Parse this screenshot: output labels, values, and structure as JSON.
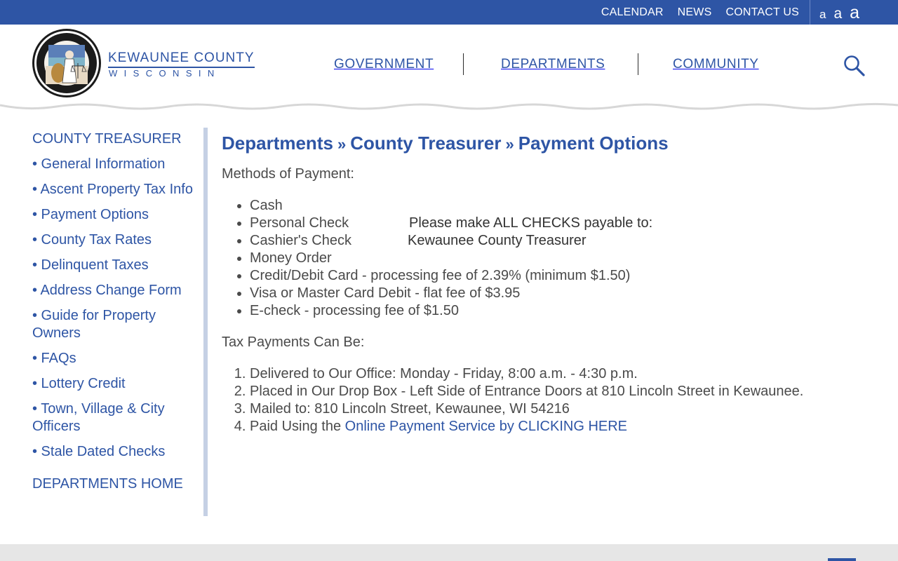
{
  "top_nav": {
    "links": [
      "CALENDAR",
      "NEWS",
      "CONTACT US"
    ],
    "font_sizes": [
      "a",
      "a",
      "a"
    ]
  },
  "brand": {
    "name": "KEWAUNEE COUNTY",
    "state": "WISCONSIN"
  },
  "main_nav": [
    "GOVERNMENT",
    "DEPARTMENTS",
    "COMMUNITY"
  ],
  "sidebar": {
    "heading": "COUNTY TREASURER",
    "items": [
      "• General Information",
      "• Ascent Property Tax Info",
      "• Payment Options",
      "• County Tax Rates",
      "• Delinquent Taxes",
      "• Address Change Form",
      "• Guide for Property Owners",
      "• FAQs",
      "• Lottery Credit",
      "• Town, Village & City Officers",
      "• Stale Dated Checks"
    ],
    "footer_link": "DEPARTMENTS HOME"
  },
  "content": {
    "breadcrumb": [
      "Departments",
      "County Treasurer",
      "Payment Options"
    ],
    "breadcrumb_sep": "»",
    "methods_heading": "Methods of Payment:",
    "methods": [
      "Cash",
      "Personal Check",
      "Cashier's Check",
      "Money Order",
      "Credit/Debit Card - processing fee of 2.39% (minimum $1.50)",
      "Visa or Master Card Debit - flat fee of $3.95",
      "E-check - processing fee of $1.50"
    ],
    "checks_note": "Please make ALL CHECKS payable to:",
    "checks_payee": "Kewaunee County Treasurer",
    "tax_heading": "Tax Payments Can Be:",
    "tax_items": [
      "Delivered to Our Office: Monday - Friday, 8:00 a.m. - 4:30 p.m.",
      "Placed in Our Drop Box - Left Side of Entrance Doors at 810 Lincoln Street in Kewaunee.",
      "Mailed to: 810 Lincoln Street, Kewaunee, WI  54216"
    ],
    "tax_item4_prefix": "Paid Using the ",
    "tax_item4_link": "Online Payment Service by CLICKING HERE"
  },
  "colors": {
    "brand_blue": "#2e55a5",
    "text_gray": "#4a4a4a",
    "sidebar_rule": "#c5d0e4",
    "footer_gray": "#e6e6e6"
  },
  "icons": {
    "search": "search-icon",
    "seal": "county-seal-logo"
  }
}
